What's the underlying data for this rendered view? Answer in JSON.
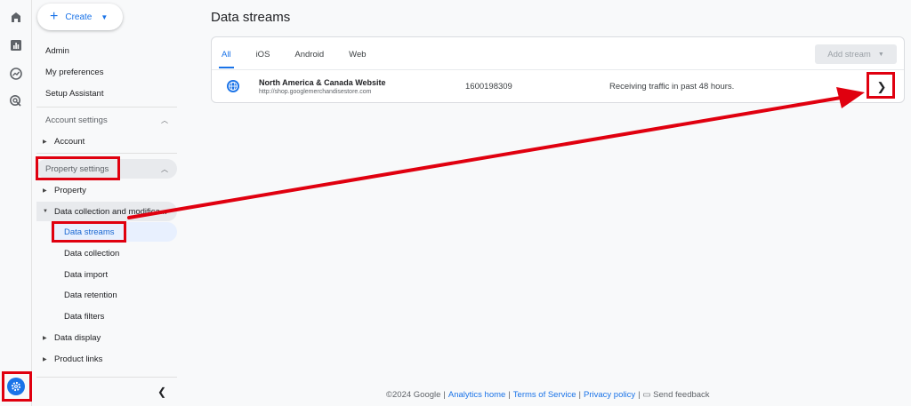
{
  "rail": {
    "icons": [
      "home-icon",
      "reports-icon",
      "explore-icon",
      "advertising-icon",
      "admin-gear-icon"
    ]
  },
  "sidebar": {
    "create_label": "Create",
    "top_items": [
      "Admin",
      "My preferences",
      "Setup Assistant"
    ],
    "account_settings": {
      "label": "Account settings",
      "items": [
        "Account"
      ]
    },
    "property_settings": {
      "label": "Property settings",
      "items": {
        "property": "Property",
        "data_collection": "Data collection and modifica...",
        "sub_items": [
          "Data streams",
          "Data collection",
          "Data import",
          "Data retention",
          "Data filters"
        ],
        "data_display": "Data display",
        "product_links": "Product links"
      }
    },
    "collapse_icon": "chevron-left-icon"
  },
  "main": {
    "title": "Data streams",
    "tabs": [
      "All",
      "iOS",
      "Android",
      "Web"
    ],
    "active_tab": "All",
    "add_stream_label": "Add stream",
    "streams": [
      {
        "name": "North America & Canada Website",
        "url": "http://shop.googlemerchandisestore.com",
        "id": "1600198309",
        "status": "Receiving traffic in past 48 hours."
      }
    ]
  },
  "footer": {
    "copyright": "©2024 Google",
    "links": [
      "Analytics home",
      "Terms of Service",
      "Privacy policy"
    ],
    "feedback": "Send feedback"
  },
  "colors": {
    "accent": "#1a73e8",
    "annotation": "#e0000f"
  }
}
